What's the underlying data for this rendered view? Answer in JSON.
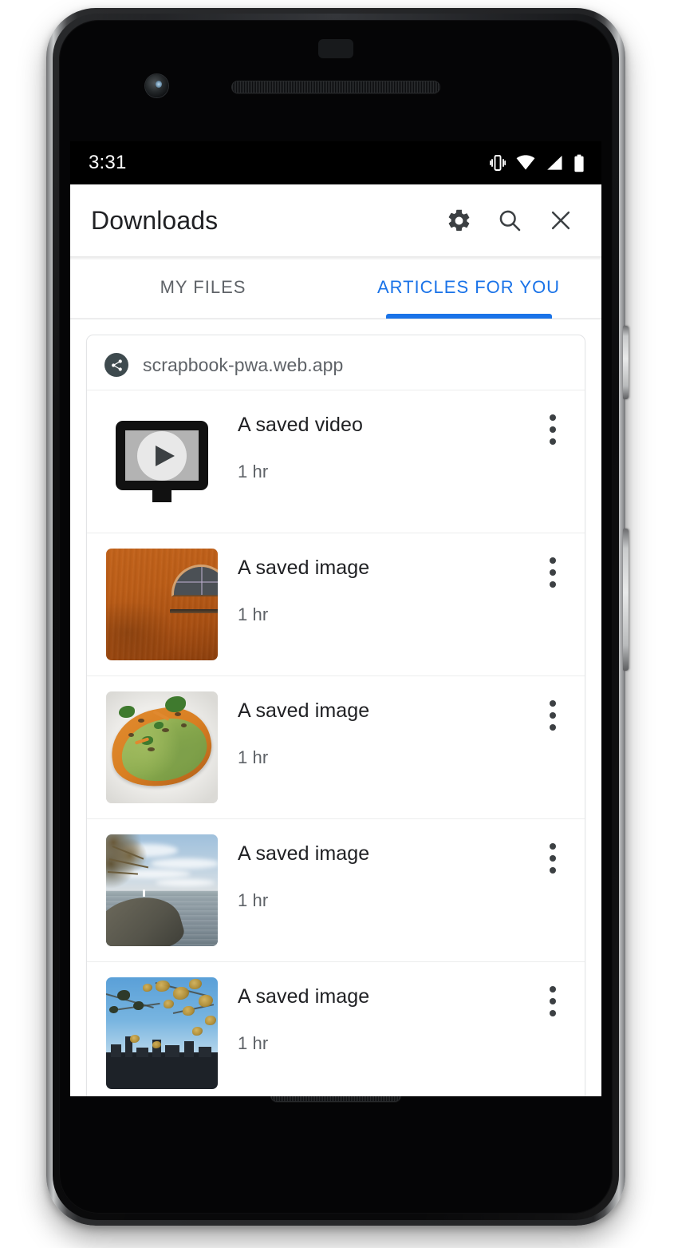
{
  "status_bar": {
    "time": "3:31",
    "icons": [
      "vibrate-icon",
      "wifi-icon",
      "signal-icon",
      "battery-icon"
    ]
  },
  "app_bar": {
    "title": "Downloads",
    "actions": [
      {
        "name": "settings-button",
        "icon": "gear-icon"
      },
      {
        "name": "search-button",
        "icon": "search-icon"
      },
      {
        "name": "close-button",
        "icon": "close-icon"
      }
    ]
  },
  "tabs": {
    "items": [
      {
        "label": "MY FILES",
        "active": false
      },
      {
        "label": "ARTICLES FOR YOU",
        "active": true
      }
    ],
    "active_color": "#1a73e8",
    "inactive_color": "#5f6368"
  },
  "card": {
    "source": {
      "label": "scrapbook-pwa.web.app",
      "avatar_icon": "share-icon",
      "avatar_color": "#3e4a4e"
    },
    "items": [
      {
        "title": "A saved video",
        "subtitle": "1 hr",
        "thumbnail": "video-placeholder-icon",
        "menu_icon": "more-vertical-icon"
      },
      {
        "title": "A saved image",
        "subtitle": "1 hr",
        "thumbnail": "photo-orange-wall",
        "menu_icon": "more-vertical-icon"
      },
      {
        "title": "A saved image",
        "subtitle": "1 hr",
        "thumbnail": "photo-avocado-toast",
        "menu_icon": "more-vertical-icon"
      },
      {
        "title": "A saved image",
        "subtitle": "1 hr",
        "thumbnail": "photo-lake-shore",
        "menu_icon": "more-vertical-icon"
      },
      {
        "title": "A saved image",
        "subtitle": "1 hr",
        "thumbnail": "photo-city-skyline",
        "menu_icon": "more-vertical-icon"
      }
    ]
  }
}
